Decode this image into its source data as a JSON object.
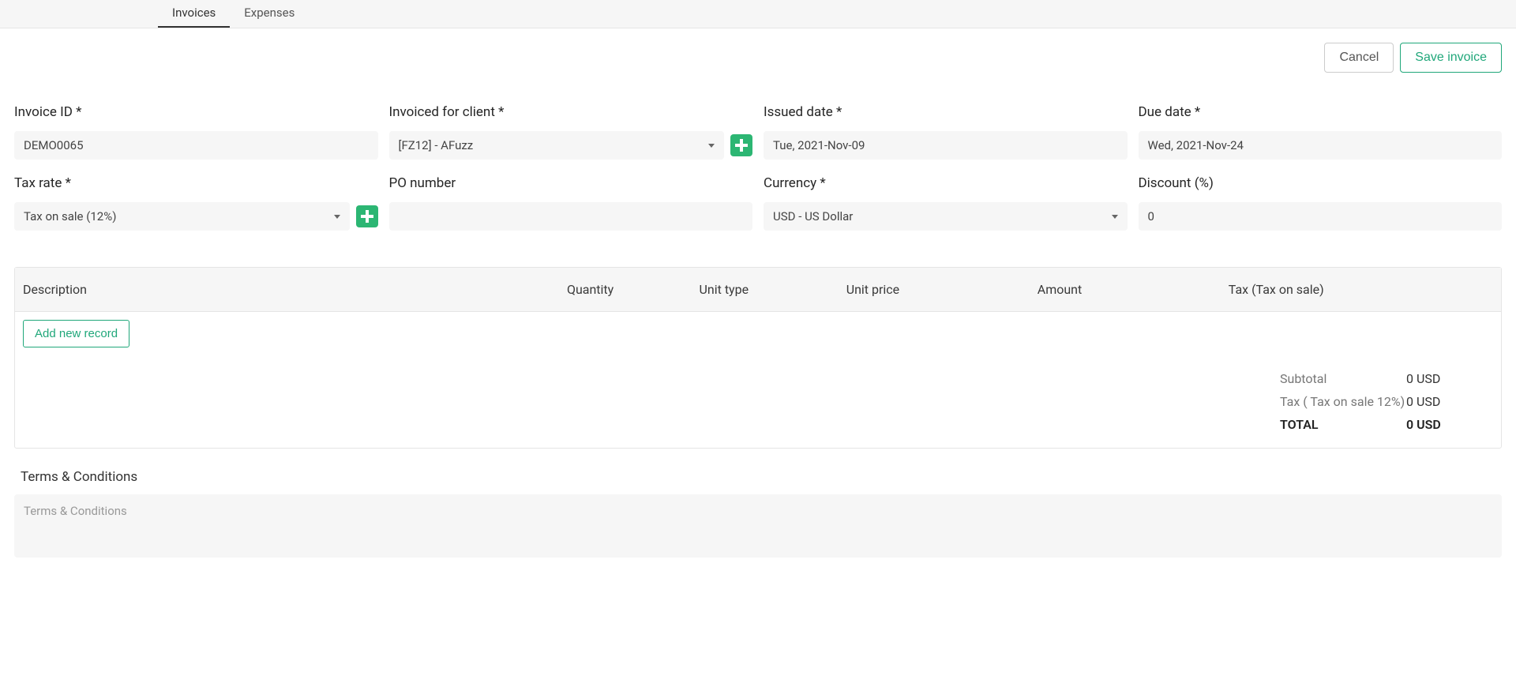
{
  "tabs": {
    "invoices": "Invoices",
    "expenses": "Expenses"
  },
  "actions": {
    "cancel": "Cancel",
    "save": "Save invoice"
  },
  "form": {
    "invoice_id": {
      "label": "Invoice ID *",
      "value": "DEMO0065"
    },
    "client": {
      "label": "Invoiced for client *",
      "value": "[FZ12] - AFuzz"
    },
    "issued": {
      "label": "Issued date *",
      "value": "Tue, 2021-Nov-09"
    },
    "due": {
      "label": "Due date *",
      "value": "Wed, 2021-Nov-24"
    },
    "tax_rate": {
      "label": "Tax rate *",
      "value": "Tax on sale (12%)"
    },
    "po": {
      "label": "PO number",
      "value": ""
    },
    "currency": {
      "label": "Currency *",
      "value": "USD - US Dollar"
    },
    "discount": {
      "label": "Discount (%)",
      "value": "0"
    }
  },
  "table": {
    "headers": {
      "description": "Description",
      "quantity": "Quantity",
      "unit_type": "Unit type",
      "unit_price": "Unit price",
      "amount": "Amount",
      "tax": "Tax (Tax on sale)"
    },
    "add_record": "Add new record"
  },
  "totals": {
    "subtotal_label": "Subtotal",
    "subtotal_value": "0 USD",
    "tax_label": "Tax ( Tax on sale 12%)",
    "tax_value": "0 USD",
    "total_label": "TOTAL",
    "total_value": "0 USD"
  },
  "terms": {
    "title": "Terms & Conditions",
    "placeholder": "Terms & Conditions"
  }
}
